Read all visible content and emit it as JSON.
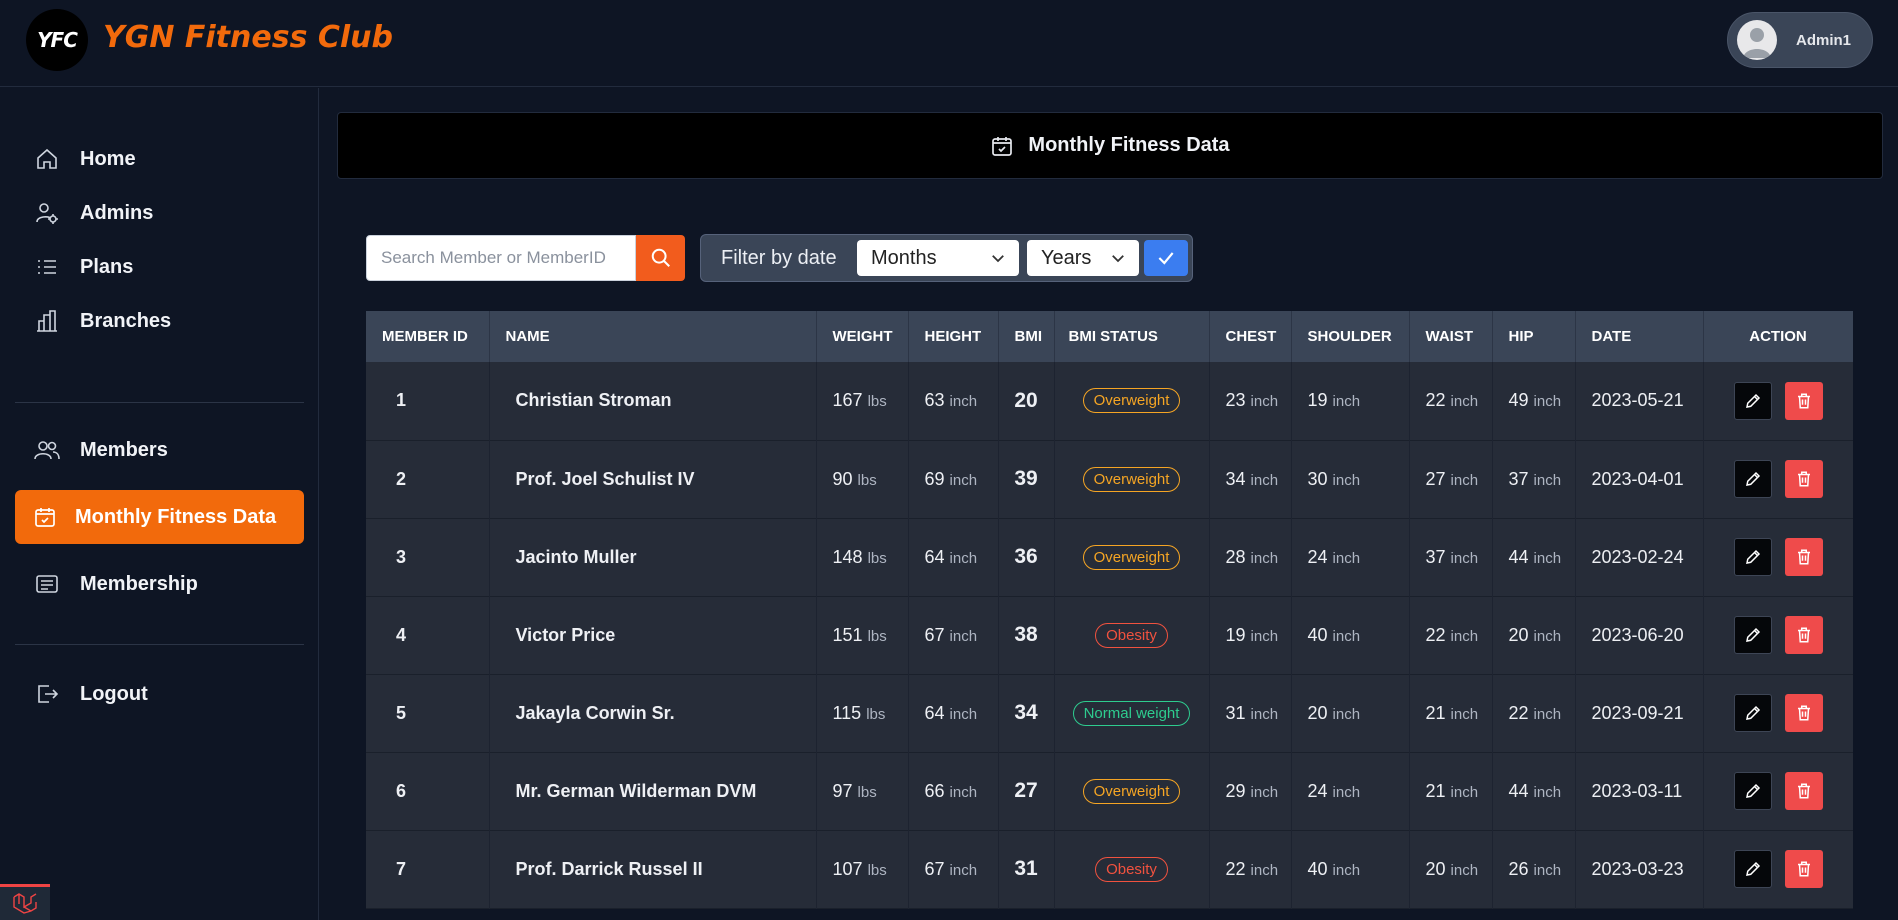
{
  "header": {
    "logo_mark": "YFC",
    "brand": "YGN Fitness Club",
    "user_name": "Admin1"
  },
  "sidebar": {
    "items": [
      {
        "label": "Home",
        "icon": "home-icon"
      },
      {
        "label": "Admins",
        "icon": "user-gear-icon"
      },
      {
        "label": "Plans",
        "icon": "list-icon"
      },
      {
        "label": "Branches",
        "icon": "buildings-icon"
      },
      {
        "label": "Members",
        "icon": "users-icon"
      },
      {
        "label": "Monthly Fitness Data",
        "icon": "calendar-check-icon",
        "active": true
      },
      {
        "label": "Membership",
        "icon": "id-card-icon"
      },
      {
        "label": "Logout",
        "icon": "logout-icon"
      }
    ]
  },
  "page": {
    "title": "Monthly Fitness Data"
  },
  "search": {
    "placeholder": "Search Member or MemberID",
    "value": ""
  },
  "filter": {
    "label": "Filter by date",
    "month_select": "Months",
    "year_select": "Years"
  },
  "table": {
    "columns": [
      "MEMBER ID",
      "NAME",
      "WEIGHT",
      "HEIGHT",
      "BMI",
      "BMI STATUS",
      "CHEST",
      "SHOULDER",
      "WAIST",
      "HIP",
      "DATE",
      "ACTION"
    ],
    "units": {
      "weight": "lbs",
      "length": "inch"
    },
    "rows": [
      {
        "id": "1",
        "name": "Christian Stroman",
        "weight": "167",
        "height": "63",
        "bmi": "20",
        "status": "Overweight",
        "chest": "23",
        "shoulder": "19",
        "waist": "22",
        "hip": "49",
        "date": "2023-05-21"
      },
      {
        "id": "2",
        "name": "Prof. Joel Schulist IV",
        "weight": "90",
        "height": "69",
        "bmi": "39",
        "status": "Overweight",
        "chest": "34",
        "shoulder": "30",
        "waist": "27",
        "hip": "37",
        "date": "2023-04-01"
      },
      {
        "id": "3",
        "name": "Jacinto Muller",
        "weight": "148",
        "height": "64",
        "bmi": "36",
        "status": "Overweight",
        "chest": "28",
        "shoulder": "24",
        "waist": "37",
        "hip": "44",
        "date": "2023-02-24"
      },
      {
        "id": "4",
        "name": "Victor Price",
        "weight": "151",
        "height": "67",
        "bmi": "38",
        "status": "Obesity",
        "chest": "19",
        "shoulder": "40",
        "waist": "22",
        "hip": "20",
        "date": "2023-06-20"
      },
      {
        "id": "5",
        "name": "Jakayla Corwin Sr.",
        "weight": "115",
        "height": "64",
        "bmi": "34",
        "status": "Normal weight",
        "chest": "31",
        "shoulder": "20",
        "waist": "21",
        "hip": "22",
        "date": "2023-09-21"
      },
      {
        "id": "6",
        "name": "Mr. German Wilderman DVM",
        "weight": "97",
        "height": "66",
        "bmi": "27",
        "status": "Overweight",
        "chest": "29",
        "shoulder": "24",
        "waist": "21",
        "hip": "44",
        "date": "2023-03-11"
      },
      {
        "id": "7",
        "name": "Prof. Darrick Russel II",
        "weight": "107",
        "height": "67",
        "bmi": "31",
        "status": "Obesity",
        "chest": "22",
        "shoulder": "40",
        "waist": "20",
        "hip": "26",
        "date": "2023-03-23"
      }
    ]
  },
  "colors": {
    "accent": "#f26a0c",
    "overweight": "#f5a524",
    "obesity": "#f0523f",
    "normal": "#2ecc8f",
    "delete": "#ef4b4b",
    "confirm": "#3b7df0"
  }
}
